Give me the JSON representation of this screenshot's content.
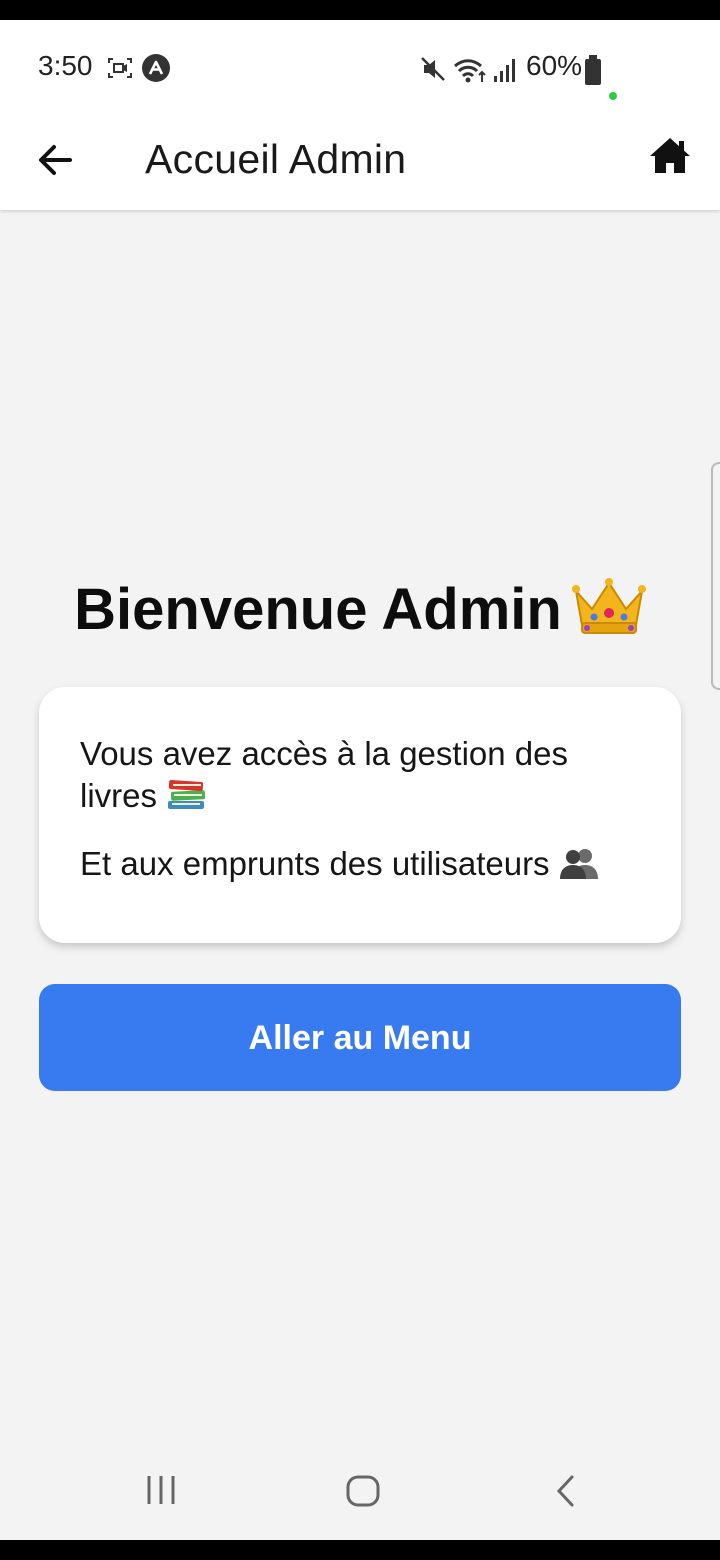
{
  "status_bar": {
    "time": "3:50",
    "battery": "60%",
    "icons": [
      "screen-recorder-icon",
      "app-notification-icon",
      "mute-icon",
      "wifi-icon",
      "signal-icon",
      "battery-icon",
      "active-dot-icon"
    ]
  },
  "appbar": {
    "title": "Accueil Admin",
    "back_icon": "arrow-left-icon",
    "home_icon": "home-icon"
  },
  "main": {
    "welcome": "Bienvenue Admin",
    "welcome_emoji": "crown-icon",
    "card": {
      "line1": "Vous avez accès à la gestion des livres",
      "line1_emoji": "books-icon",
      "line2": "Et aux emprunts des utilisateurs",
      "line2_emoji": "users-icon"
    },
    "button_label": "Aller au Menu"
  },
  "navbar": {
    "icons": [
      "recent-apps-icon",
      "home-nav-icon",
      "back-nav-icon"
    ]
  },
  "colors": {
    "primary_button": "#387bf0",
    "background": "#f3f3f4",
    "card": "#ffffff",
    "appbar": "#ffffff"
  }
}
